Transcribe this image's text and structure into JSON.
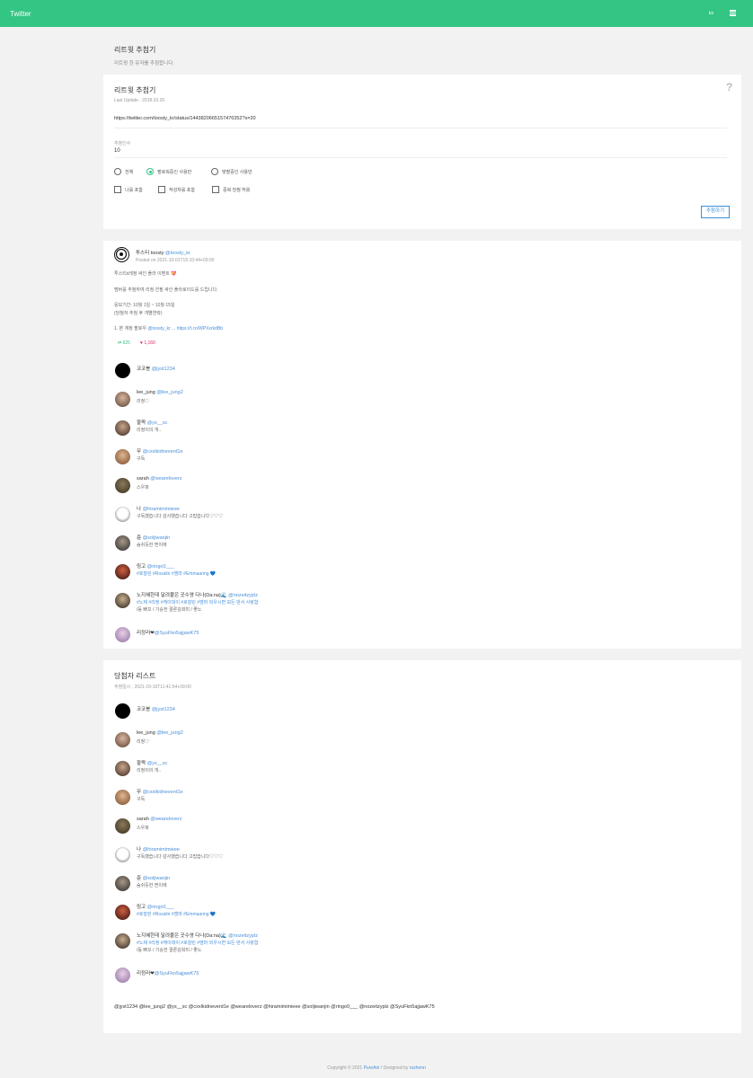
{
  "app": {
    "brand": "Twitter",
    "lang_label": "ks"
  },
  "page": {
    "title": "리트윗 추첨기",
    "subtitle": "리트윗 한 유저를 추첨합니다."
  },
  "form": {
    "title": "리트윗 추첨기",
    "last_update": "Last Update : 2018.03.26",
    "help": "?",
    "url_value": "https://twitter.com/toosty_kr/status/1443820665157476352?s=20",
    "count_label": "추첨인수",
    "count_value": "10",
    "radios": [
      {
        "label": "전체",
        "selected": false
      },
      {
        "label": "팔로워중인 사용만",
        "selected": true
      },
      {
        "label": "맞팔중인 사용만",
        "selected": false
      }
    ],
    "checks": [
      {
        "label": "나를 포함",
        "checked": false
      },
      {
        "label": "작성자를 포함",
        "checked": false
      },
      {
        "label": "중복 당첨 허용",
        "checked": false
      }
    ],
    "submit_label": "추첨하기"
  },
  "tweet": {
    "author_name": "투스티 toosty",
    "author_handle": "@toosty_kr",
    "posted": "Posted on 2021-10-01T15:10:44+09:00",
    "lines": [
      "투스티x레정 싸인 폴라 이벤트 💝",
      "",
      "멤버를 추첨하여 리정 친필 싸인 폴라로이드를 드립니다.",
      "",
      "응모기간: 10월 1일 ~ 10월 15일",
      "(당첨자 추첨 후 개별연락)",
      "",
      "1. 본 계정 팔로우"
    ],
    "follow_link": "@toosty_kr",
    "tail": "... https://t.co/WPXxrkdBb",
    "retweets": "⇄ 625",
    "likes": "♥ 1,160"
  },
  "retweeters": [
    {
      "name": "코코봉",
      "handle": "@jyst1234",
      "text": ""
    },
    {
      "name": "lee_jung",
      "handle": "@lee_jung2",
      "text": "리정♡"
    },
    {
      "name": "팔짝",
      "handle": "@ys__sc",
      "text": "리정이의 개.."
    },
    {
      "name": "무",
      "handle": "@cxxlkidneverd1e",
      "text": "구독"
    },
    {
      "name": "sarah",
      "handle": "@weareloverz",
      "text": "스우파"
    },
    {
      "name": "나",
      "handle": "@hiramimimieee",
      "text": "구독했습니다 감사했습니다 고맙습니다♡♡♡"
    },
    {
      "name": "쥰",
      "handle": "@soljiwanjin",
      "text": "숨쉬듯한 찐이에"
    },
    {
      "name": "링고",
      "handle": "@ringo0___",
      "text": "#로잘린 #Rozalin #엠마 #Emmaaring 💙"
    },
    {
      "name": "노지혜한데 달려붙은 곳수영 다나(Da:na)🌊",
      "handle": "@nozeitzyplz",
      "text": "#노제 #리정 #케이데이 #로잘린 #엠마 외우시면 모든 댄서 사랑함",
      "text2": "/등 빠꼬 / 기승전 결론김희미 / 좋노"
    },
    {
      "name": "리정러❤",
      "handle": "@SyuFkn5ajjawK75",
      "text": ""
    }
  ],
  "winners_section": {
    "title": "당첨자 리스트",
    "drawn_at": "추첨일시 : 2021-10-16T11:41:54+09:00",
    "all_handles": "@jyst1234 @lee_jung2 @ys__sc @cxxlkidneverd1e @weareloverz @hiramimimieee @soljiwanjin @ringo0___ @nozeitzyplz @SyuFkn5ajjawK75"
  },
  "footer": {
    "copyright": "Copyright © 2021",
    "brand": "PureAni",
    "designed": " / Designed by",
    "designer": "rushenn"
  },
  "colors": {
    "accent": "#33c584",
    "link": "#4a90d9",
    "like": "#e0245e"
  }
}
